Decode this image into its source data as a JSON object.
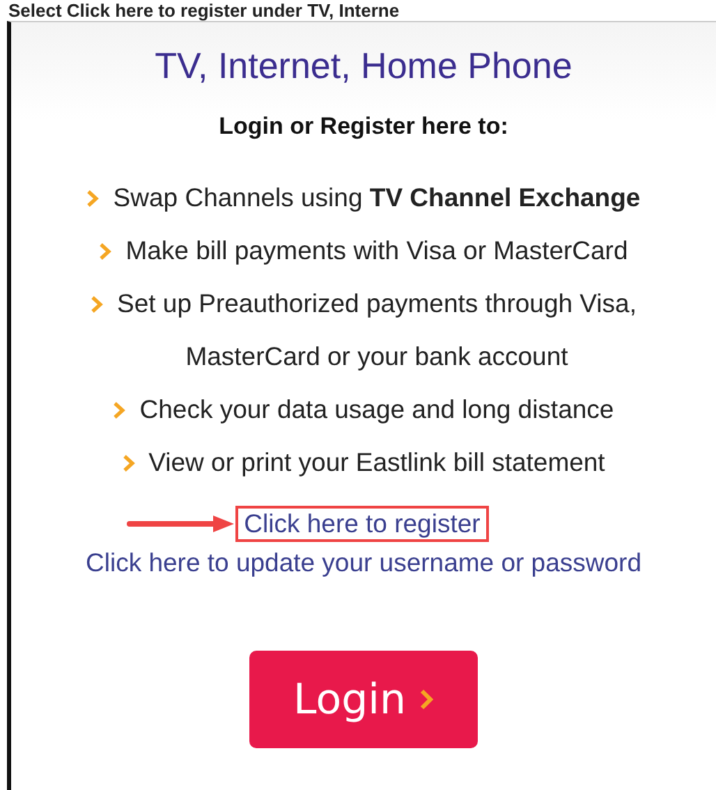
{
  "caption": "Select Click here to register under TV, Interne",
  "card": {
    "title": "TV, Internet, Home Phone",
    "subtitle": "Login or Register here to:",
    "features": [
      {
        "text": "Swap Channels using **TV Channel Exchange**"
      },
      {
        "text": "Make bill payments with Visa or MasterCard"
      },
      {
        "text": "Set up Preauthorized payments through Visa,\nMasterCard or your bank account"
      },
      {
        "text": "Check your data usage and long distance"
      },
      {
        "text": "View or print your Eastlink bill statement"
      }
    ],
    "links": [
      {
        "text": "Click here to register",
        "highlighted": true
      },
      {
        "text": "Click here to update your username or password",
        "highlighted": false
      }
    ],
    "button": "Login"
  }
}
